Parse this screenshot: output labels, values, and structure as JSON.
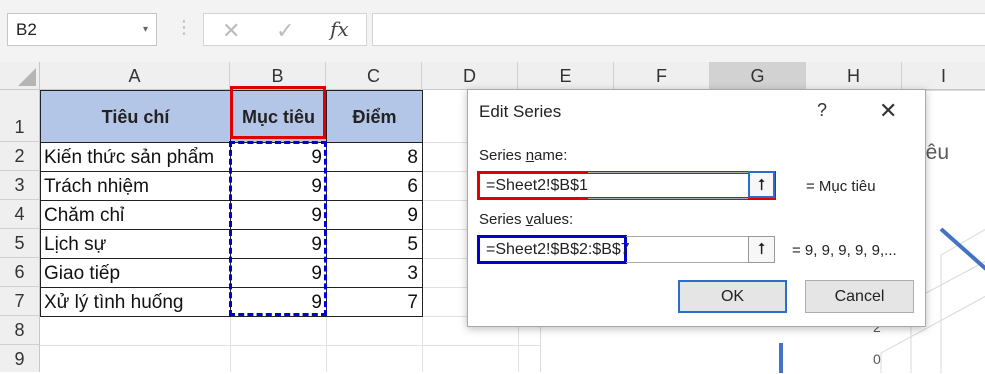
{
  "formula_bar": {
    "name_box": "B2",
    "dropdown_glyph": "▾",
    "separator_glyph": "⋮",
    "cancel_glyph": "✕",
    "enter_glyph": "✓",
    "fx_label": "fx",
    "formula": ""
  },
  "columns": [
    "A",
    "B",
    "C",
    "D",
    "E",
    "F",
    "G",
    "H",
    "I"
  ],
  "rows": [
    "1",
    "2",
    "3",
    "4",
    "5",
    "6",
    "7",
    "8",
    "9"
  ],
  "table": {
    "headers": [
      "Tiêu chí",
      "Mục tiêu",
      "Điểm"
    ],
    "data": [
      [
        "Kiến thức sản phẩm",
        "9",
        "8"
      ],
      [
        "Trách nhiệm",
        "9",
        "6"
      ],
      [
        "Chăm chỉ",
        "9",
        "9"
      ],
      [
        "Lịch sự",
        "9",
        "5"
      ],
      [
        "Giao tiếp",
        "9",
        "3"
      ],
      [
        "Xử lý tình huống",
        "9",
        "7"
      ]
    ]
  },
  "chart_fragments": {
    "title_partial": "iêu",
    "tick_2": "2",
    "tick_0": "0"
  },
  "dialog": {
    "title": "Edit Series",
    "help": "?",
    "close": "✕",
    "series_name_label_pre": "Series ",
    "series_name_label_u": "n",
    "series_name_label_post": "ame:",
    "series_name_value": "=Sheet2!$B$1",
    "series_name_preview": "= Mục tiêu",
    "series_values_label_pre": "Series ",
    "series_values_label_u": "v",
    "series_values_label_post": "alues:",
    "series_values_value": "=Sheet2!$B$2:$B$7",
    "series_values_preview": "= 9, 9, 9, 9, 9,...",
    "ref_glyph": "⭡",
    "ok": "OK",
    "cancel": "Cancel"
  },
  "colors": {
    "header_fill": "#b4c6e7",
    "red_highlight": "#e00000",
    "blue_highlight": "#0000d0",
    "chart_line": "#4472c4",
    "selection_green": "#217346"
  }
}
